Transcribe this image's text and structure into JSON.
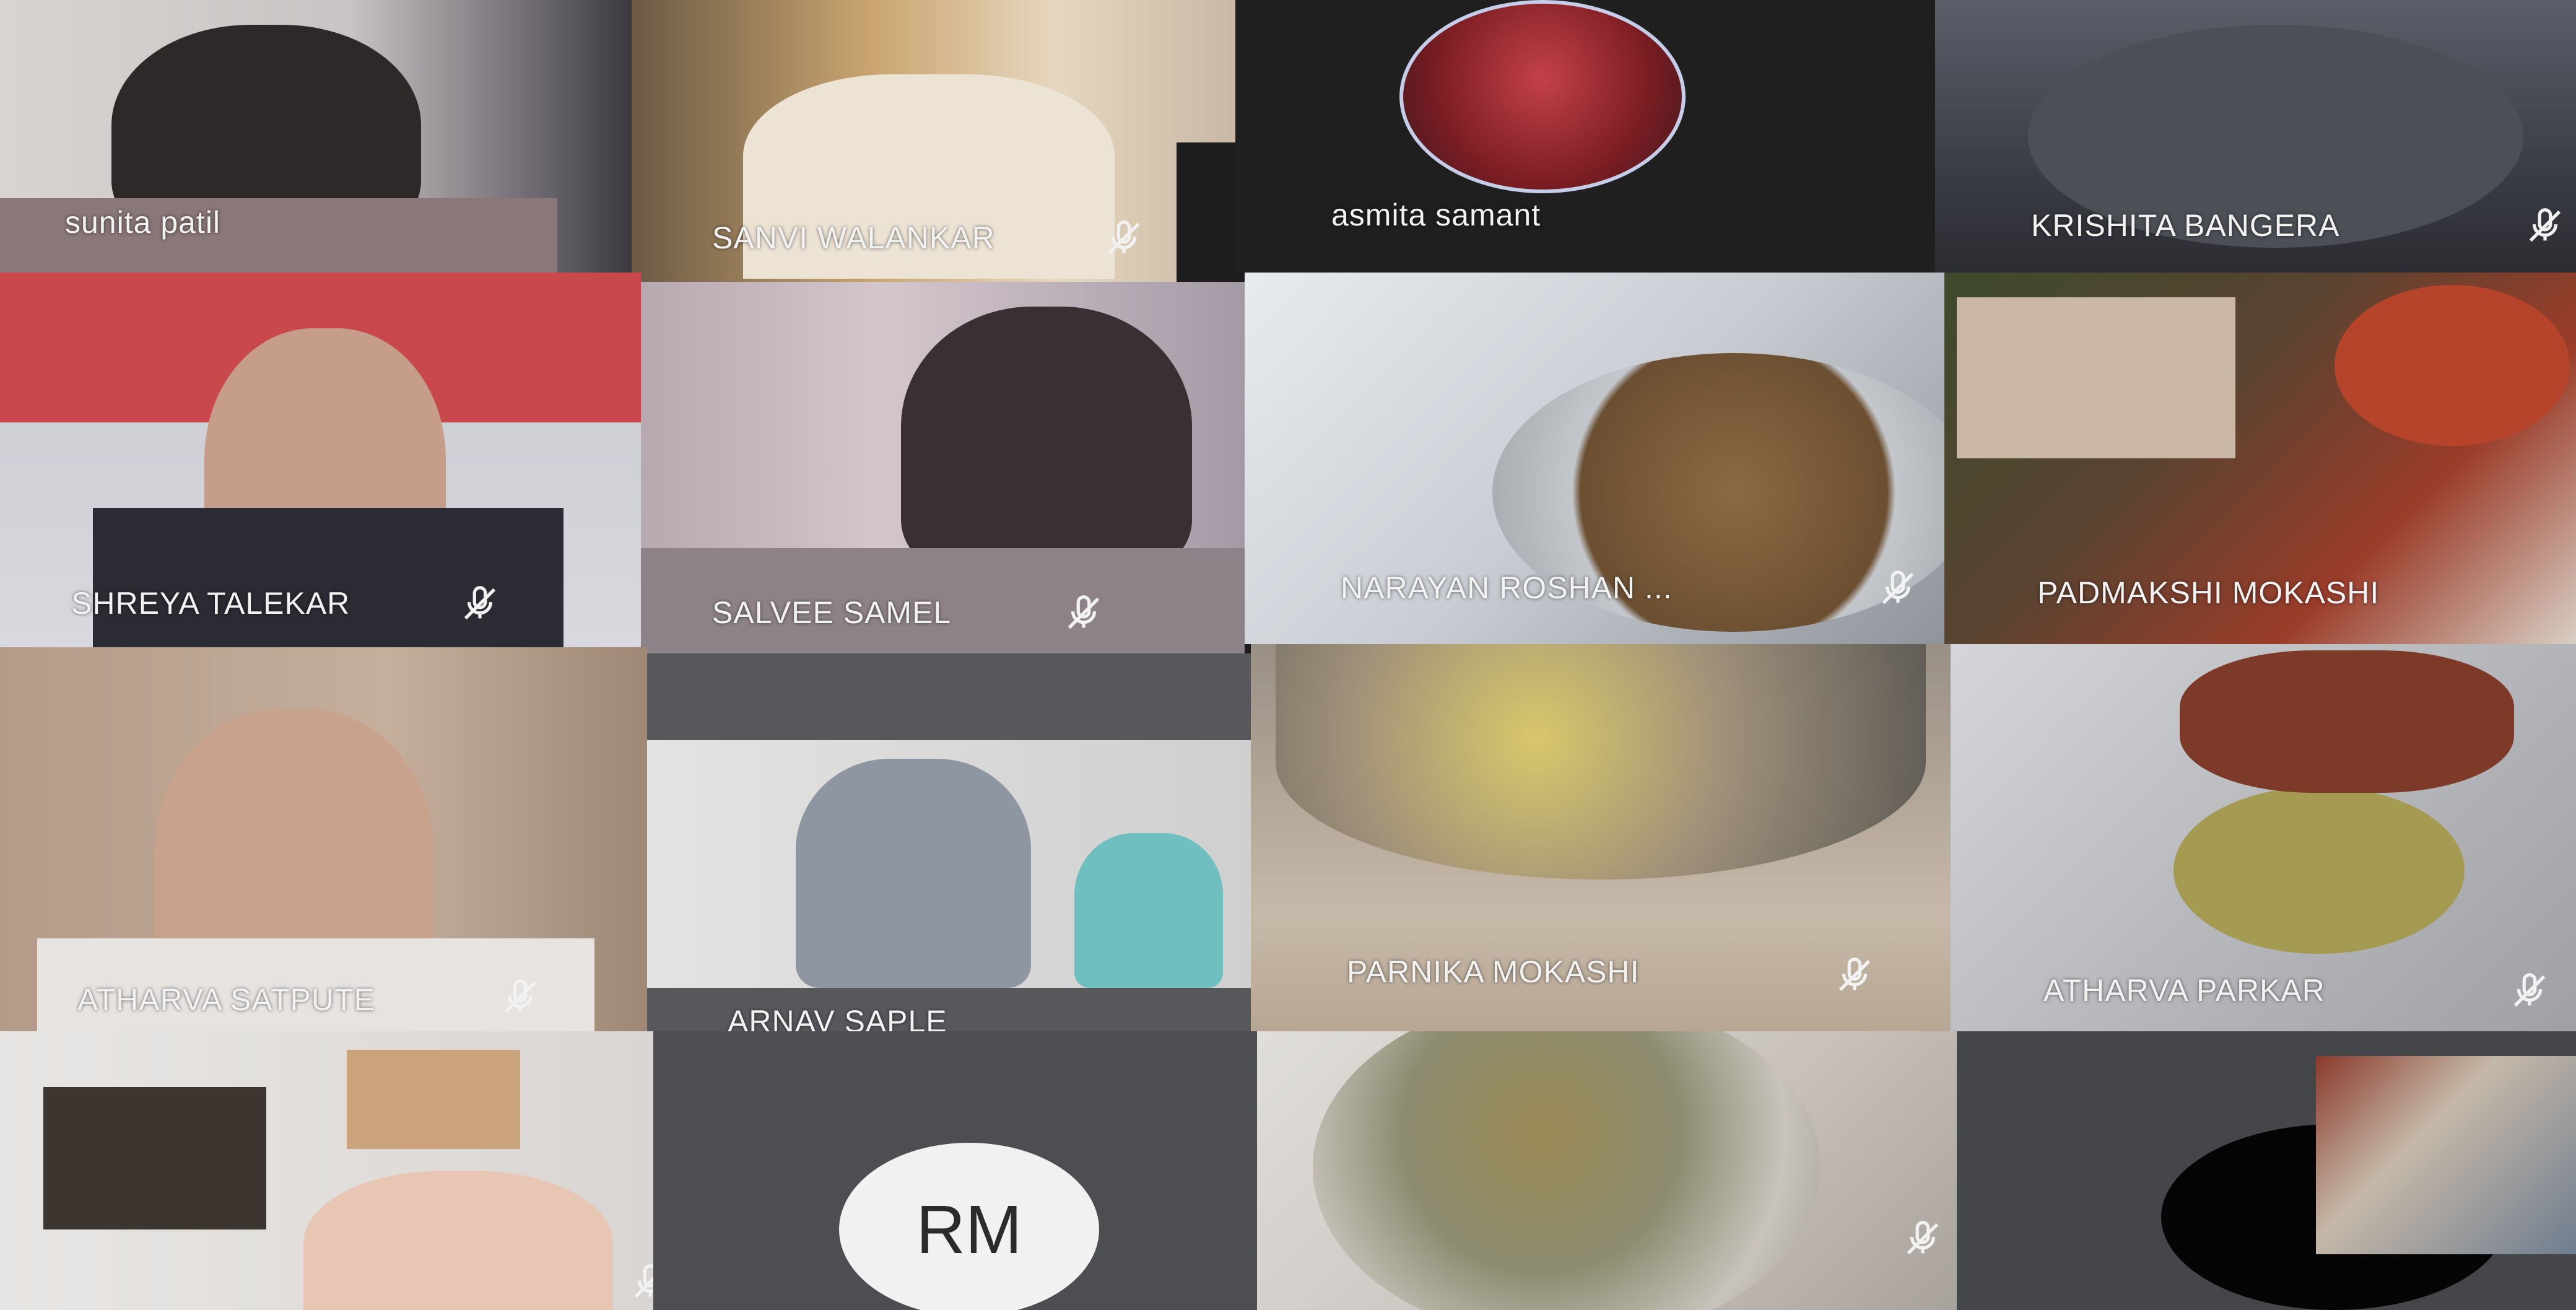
{
  "meeting": {
    "participants": [
      {
        "name": "sunita patil",
        "muted": false
      },
      {
        "name": "SANVI WALANKAR",
        "muted": true
      },
      {
        "name": "asmita samant",
        "muted": false
      },
      {
        "name": "KRISHITA BANGERA",
        "muted": true
      },
      {
        "name": "SHREYA TALEKAR",
        "muted": true
      },
      {
        "name": "SALVEE SAMEL",
        "muted": true
      },
      {
        "name": "NARAYAN ROSHAN ...",
        "muted": true
      },
      {
        "name": "PADMAKSHI MOKASHI",
        "muted": false
      },
      {
        "name": "ATHARVA SATPUTE",
        "muted": true
      },
      {
        "name": "ARNAV SAPLE",
        "muted": false
      },
      {
        "name": "PARNIKA MOKASHI",
        "muted": true
      },
      {
        "name": "ATHARVA PARKAR",
        "muted": true
      },
      {
        "name": "",
        "muted": true
      },
      {
        "name": "",
        "muted": false,
        "initials": "RM"
      },
      {
        "name": "",
        "muted": true
      },
      {
        "name": "",
        "muted": false
      }
    ]
  },
  "icons": {
    "mute": "microphone-muted-icon"
  }
}
